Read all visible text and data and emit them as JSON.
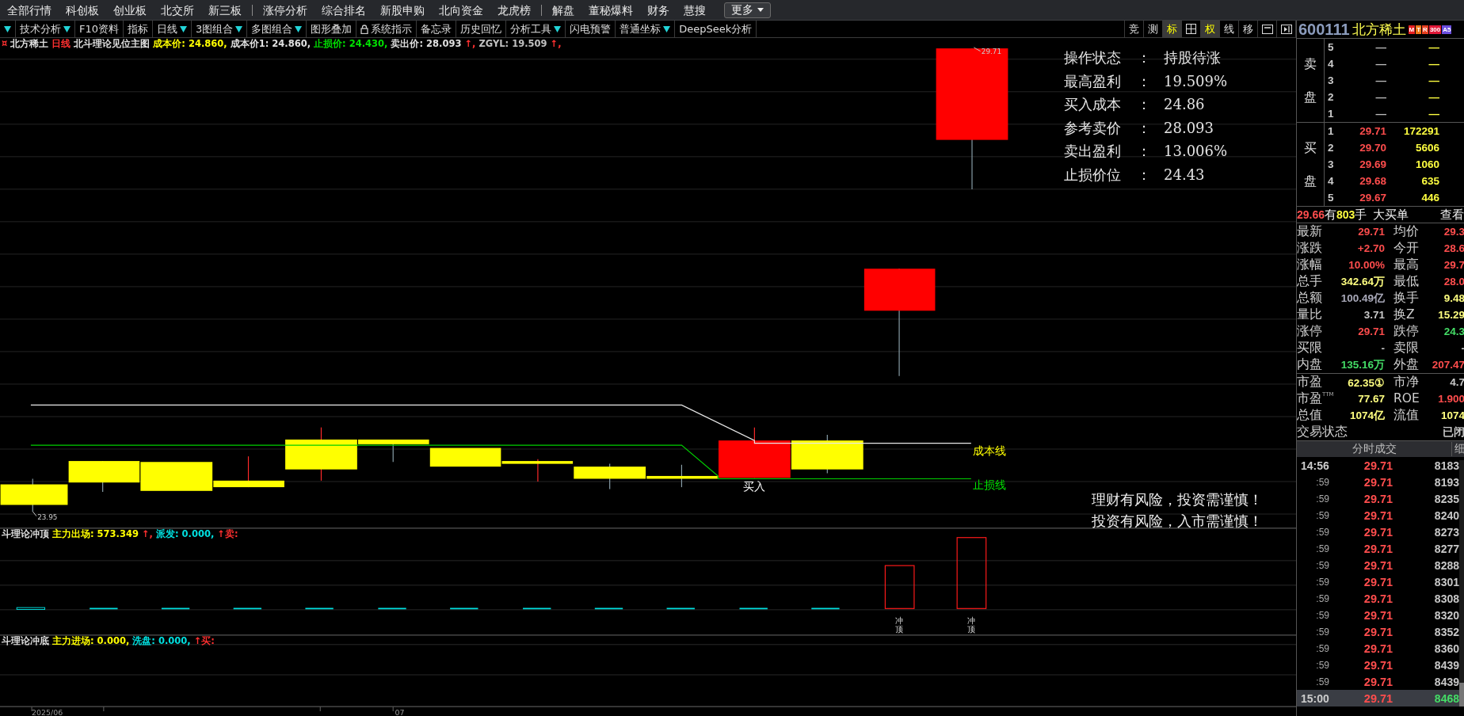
{
  "menu": {
    "items": [
      {
        "label": "全部行情",
        "divider_after": false
      },
      {
        "label": "科创板",
        "divider_after": false
      },
      {
        "label": "创业板",
        "divider_after": false
      },
      {
        "label": "北交所",
        "divider_after": false
      },
      {
        "label": "新三板",
        "divider_after": true
      },
      {
        "label": "涨停分析",
        "divider_after": false
      },
      {
        "label": "综合排名",
        "divider_after": false
      },
      {
        "label": "新股申购",
        "divider_after": false
      },
      {
        "label": "北向资金",
        "divider_after": false
      },
      {
        "label": "龙虎榜",
        "divider_after": true
      },
      {
        "label": "解盘",
        "divider_after": false
      },
      {
        "label": "董秘爆料",
        "divider_after": false
      },
      {
        "label": "财务",
        "divider_after": false
      },
      {
        "label": "慧搜",
        "divider_after": false
      }
    ],
    "more": "更多"
  },
  "toolbar": {
    "items": [
      {
        "has_menu": true,
        "locked": false
      },
      {
        "label": "技术分析",
        "has_menu": true,
        "locked": false
      },
      {
        "label": "F10资料",
        "has_menu": false,
        "locked": false
      },
      {
        "label": "指标",
        "has_menu": false,
        "locked": false
      },
      {
        "label": "日线",
        "has_menu": true,
        "locked": false
      },
      {
        "label": "3图组合",
        "has_menu": true,
        "locked": false
      },
      {
        "label": "多图组合",
        "has_menu": true,
        "locked": false
      },
      {
        "label": "图形叠加",
        "has_menu": false,
        "locked": false
      },
      {
        "label": "系统指示",
        "has_menu": false,
        "locked": true
      },
      {
        "label": "备忘录",
        "has_menu": false,
        "locked": false
      },
      {
        "label": "历史回忆",
        "has_menu": false,
        "locked": false
      },
      {
        "label": "分析工具",
        "has_menu": true,
        "locked": false
      },
      {
        "label": "闪电预警",
        "has_menu": false,
        "locked": false
      },
      {
        "label": "普通坐标",
        "has_menu": true,
        "locked": false
      },
      {
        "label": "DeepSeek分析",
        "has_menu": false,
        "locked": false
      }
    ],
    "tools": [
      {
        "kind": "text",
        "label": "竞",
        "selected": false
      },
      {
        "kind": "text",
        "label": "测",
        "selected": false
      },
      {
        "kind": "text",
        "label": "标",
        "selected": true
      },
      {
        "kind": "grid"
      },
      {
        "kind": "text",
        "label": "权",
        "selected": true
      },
      {
        "kind": "text",
        "label": "线",
        "selected": false
      },
      {
        "kind": "text",
        "label": "移",
        "selected": false
      },
      {
        "kind": "window"
      },
      {
        "kind": "panel"
      }
    ]
  },
  "chart": {
    "legend": [
      {
        "text": "¤",
        "color": "#ff3030"
      },
      {
        "text": "北方稀土",
        "color": "#e0e0e0"
      },
      {
        "text": "日线",
        "color": "#ff3030"
      },
      {
        "text": "北斗理论见位主图",
        "color": "#e0e0e0"
      },
      {
        "text": "成本价: 24.860,",
        "color": "#ffff00"
      },
      {
        "text": "成本价1: 24.860,",
        "color": "#e0e0e0"
      },
      {
        "text": "止损价: 24.430,",
        "color": "#00e000"
      },
      {
        "text": "卖出价: 28.093",
        "color": "#e0e0e0"
      },
      {
        "text": "↑,",
        "color": "#ff3030"
      },
      {
        "text": "ZGYL: 19.509",
        "color": "#c0c0c0"
      },
      {
        "text": "↑,",
        "color": "#ff3030"
      }
    ],
    "high_label": "29.71",
    "low_label": "23.95",
    "cost_line_label": "成本线",
    "stop_line_label": "止损线",
    "buy_mark": "买入",
    "signal_panel": [
      {
        "label": "操作状态",
        "sep": "：",
        "value": "持股待涨"
      },
      {
        "label": "最高盈利",
        "sep": "：",
        "value": "19.509%"
      },
      {
        "label": "买入成本",
        "sep": "：",
        "value": "24.86"
      },
      {
        "label": "参考卖价",
        "sep": "：",
        "value": "28.093"
      },
      {
        "label": "卖出盈利",
        "sep": "：",
        "value": "13.006%"
      },
      {
        "label": "止损价位",
        "sep": "：",
        "value": "24.43"
      }
    ],
    "warnings": [
      "理财有风险，投资需谨慎！",
      "投资有风险，入市需谨慎！"
    ],
    "indicators": [
      {
        "legend": [
          {
            "text": "斗理论冲顶",
            "color": "#e0e0e0"
          },
          {
            "text": "主力出场: 573.349",
            "color": "#ffff00"
          },
          {
            "text": "↑,",
            "color": "#ff3030"
          },
          {
            "text": "派发: 0.000,",
            "color": "#00e0e0"
          },
          {
            "text": "↑卖:",
            "color": "#ff3030"
          }
        ],
        "signal_labels": [
          "冲顶",
          "冲顶"
        ]
      },
      {
        "legend": [
          {
            "text": "斗理论冲底",
            "color": "#e0e0e0"
          },
          {
            "text": "主力进场: 0.000,",
            "color": "#ffff00"
          },
          {
            "text": "洗盘: 0.000,",
            "color": "#00e0e0"
          },
          {
            "text": "↑买:",
            "color": "#ff3030"
          }
        ]
      }
    ],
    "axis_labels": [
      "2025/06",
      "07"
    ]
  },
  "quote": {
    "code": "600111",
    "name": "北方稀土",
    "badges": [
      {
        "text": "M",
        "color": "#e82020"
      },
      {
        "text": "T",
        "color": "#f07818"
      },
      {
        "text": "R",
        "color": "#e84020"
      },
      {
        "text": "300",
        "color": "#e01838"
      },
      {
        "text": "A5",
        "color": "#6a4ee0"
      }
    ],
    "sell_label": "卖盘",
    "buy_label": "买盘",
    "sell": [
      {
        "level": "5",
        "price": "—",
        "volume": "—"
      },
      {
        "level": "4",
        "price": "—",
        "volume": "—"
      },
      {
        "level": "3",
        "price": "—",
        "volume": "—"
      },
      {
        "level": "2",
        "price": "—",
        "volume": "—"
      },
      {
        "level": "1",
        "price": "—",
        "volume": "—"
      }
    ],
    "buy": [
      {
        "level": "1",
        "price": "29.71",
        "volume": "172291"
      },
      {
        "level": "2",
        "price": "29.70",
        "volume": "5606"
      },
      {
        "level": "3",
        "price": "29.69",
        "volume": "1060"
      },
      {
        "level": "4",
        "price": "29.68",
        "volume": "635"
      },
      {
        "level": "5",
        "price": "29.67",
        "volume": "446"
      }
    ],
    "big_order": [
      {
        "text": "29.66",
        "color": "#ff4d4d"
      },
      {
        "text": "有",
        "color": "#f0f0f0"
      },
      {
        "text": "803",
        "color": "#ffff40"
      },
      {
        "text": "手",
        "color": "#f0f0f0"
      },
      {
        "text": "大买单",
        "color": "#f0f0f0"
      }
    ],
    "big_order_link": "查看",
    "stats": [
      {
        "left": {
          "label": "最新",
          "value": "29.71",
          "color": "#ff4d4d"
        },
        "right": {
          "label": "均价",
          "value": "29.3",
          "color": "#ff4d4d"
        }
      },
      {
        "left": {
          "label": "涨跌",
          "value": "+2.70",
          "color": "#ff4d4d"
        },
        "right": {
          "label": "今开",
          "value": "28.6",
          "color": "#ff4d4d"
        }
      },
      {
        "left": {
          "label": "涨幅",
          "value": "10.00%",
          "color": "#ff4d4d"
        },
        "right": {
          "label": "最高",
          "value": "29.7",
          "color": "#ff4d4d"
        }
      },
      {
        "left": {
          "label": "总手",
          "value": "342.64万",
          "color": "#ffff80"
        },
        "right": {
          "label": "最低",
          "value": "28.0",
          "color": "#ff4d4d"
        }
      },
      {
        "left": {
          "label": "总额",
          "value": "100.49亿",
          "color": "#a8a8b8"
        },
        "right": {
          "label": "换手",
          "value": "9.48",
          "color": "#ffff80"
        }
      },
      {
        "left": {
          "label": "量比",
          "value": "3.71",
          "color": "#c8c8c8"
        },
        "right": {
          "label": "换Z",
          "value": "15.29",
          "color": "#ffff80"
        }
      },
      {
        "left": {
          "label": "涨停",
          "value": "29.71",
          "color": "#ff4d4d"
        },
        "right": {
          "label": "跌停",
          "value": "24.3",
          "color": "#44dd66"
        }
      },
      {
        "left": {
          "label": "买限",
          "value": "-",
          "color": "#c8c8c8"
        },
        "right": {
          "label": "卖限",
          "value": "-",
          "color": "#c8c8c8"
        }
      },
      {
        "left": {
          "label": "内盘",
          "value": "135.16万",
          "color": "#44dd66"
        },
        "right": {
          "label": "外盘",
          "value": "207.47",
          "color": "#ff4d4d"
        }
      }
    ],
    "valuation": [
      {
        "left": {
          "label": "市盈",
          "value": "62.35①",
          "color": "#ffff80"
        },
        "right": {
          "label": "市净",
          "value": "4.7",
          "color": "#c8c8c8"
        }
      },
      {
        "left": {
          "label": "市盈$^{TTM}$",
          "value": "77.67",
          "color": "#ffff80"
        },
        "right": {
          "label": "ROE",
          "value": "1.900",
          "color": "#ff4d4d"
        }
      },
      {
        "left": {
          "label": "总值",
          "value": "1074亿",
          "color": "#ffff80"
        },
        "right": {
          "label": "流值",
          "value": "1074",
          "color": "#ffff80"
        }
      },
      {
        "left": {
          "label": "交易状态"
        },
        "right": {
          "value": "已闭",
          "color": "#c8c8c8"
        }
      }
    ],
    "ticks_title": "分时成交",
    "detail_tab": "细",
    "trades": [
      {
        "time": "14:56",
        "kind": "minute",
        "price": "29.71",
        "volume": "8183",
        "color": "#c8c8c8",
        "selected": false
      },
      {
        "time": ":59",
        "kind": "second",
        "price": "29.71",
        "volume": "8193",
        "color": "#c8c8c8",
        "selected": false
      },
      {
        "time": ":59",
        "kind": "second",
        "price": "29.71",
        "volume": "8235",
        "color": "#c8c8c8",
        "selected": false
      },
      {
        "time": ":59",
        "kind": "second",
        "price": "29.71",
        "volume": "8240",
        "color": "#c8c8c8",
        "selected": false
      },
      {
        "time": ":59",
        "kind": "second",
        "price": "29.71",
        "volume": "8273",
        "color": "#c8c8c8",
        "selected": false
      },
      {
        "time": ":59",
        "kind": "second",
        "price": "29.71",
        "volume": "8277",
        "color": "#c8c8c8",
        "selected": false
      },
      {
        "time": ":59",
        "kind": "second",
        "price": "29.71",
        "volume": "8288",
        "color": "#c8c8c8",
        "selected": false
      },
      {
        "time": ":59",
        "kind": "second",
        "price": "29.71",
        "volume": "8301",
        "color": "#c8c8c8",
        "selected": false
      },
      {
        "time": ":59",
        "kind": "second",
        "price": "29.71",
        "volume": "8308",
        "color": "#c8c8c8",
        "selected": false
      },
      {
        "time": ":59",
        "kind": "second",
        "price": "29.71",
        "volume": "8320",
        "color": "#c8c8c8",
        "selected": false
      },
      {
        "time": ":59",
        "kind": "second",
        "price": "29.71",
        "volume": "8352",
        "color": "#c8c8c8",
        "selected": false
      },
      {
        "time": ":59",
        "kind": "second",
        "price": "29.71",
        "volume": "8360",
        "color": "#c8c8c8",
        "selected": false
      },
      {
        "time": ":59",
        "kind": "second",
        "price": "29.71",
        "volume": "8439",
        "color": "#c8c8c8",
        "selected": false
      },
      {
        "time": ":59",
        "kind": "second",
        "price": "29.71",
        "volume": "8439",
        "color": "#c8c8c8",
        "selected": false
      },
      {
        "time": "15:00",
        "kind": "minute",
        "price": "29.71",
        "volume": "8468",
        "color": "#44dd66",
        "selected": true
      }
    ]
  }
}
